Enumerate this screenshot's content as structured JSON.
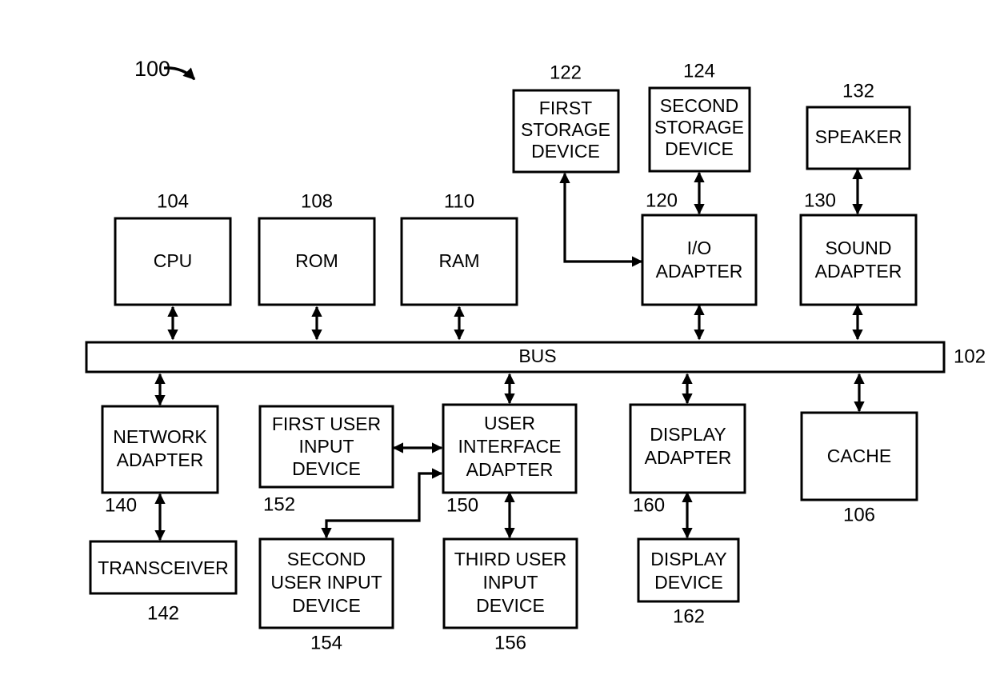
{
  "figure": {
    "figure_ref": "100",
    "background_color": "#ffffff",
    "line_color": "#000000"
  },
  "bus": {
    "label": "BUS",
    "ref": "102"
  },
  "blocks": [
    {
      "id": "cpu",
      "lines": [
        "CPU"
      ],
      "ref": "104"
    },
    {
      "id": "rom",
      "lines": [
        "ROM"
      ],
      "ref": "108"
    },
    {
      "id": "ram",
      "lines": [
        "RAM"
      ],
      "ref": "110"
    },
    {
      "id": "first-storage",
      "lines": [
        "FIRST",
        "STORAGE",
        "DEVICE"
      ],
      "ref": "122"
    },
    {
      "id": "second-storage",
      "lines": [
        "SECOND",
        "STORAGE",
        "DEVICE"
      ],
      "ref": "124"
    },
    {
      "id": "io-adapter",
      "lines": [
        "I/O",
        "ADAPTER"
      ],
      "ref": "120"
    },
    {
      "id": "speaker",
      "lines": [
        "SPEAKER"
      ],
      "ref": "132"
    },
    {
      "id": "sound-adapter",
      "lines": [
        "SOUND",
        "ADAPTER"
      ],
      "ref": "130"
    },
    {
      "id": "network-adapter",
      "lines": [
        "NETWORK",
        "ADAPTER"
      ],
      "ref": "140"
    },
    {
      "id": "transceiver",
      "lines": [
        "TRANSCEIVER"
      ],
      "ref": "142"
    },
    {
      "id": "first-user-input",
      "lines": [
        "FIRST USER",
        "INPUT",
        "DEVICE"
      ],
      "ref": "152"
    },
    {
      "id": "ui-adapter",
      "lines": [
        "USER",
        "INTERFACE",
        "ADAPTER"
      ],
      "ref": "150"
    },
    {
      "id": "second-user-input",
      "lines": [
        "SECOND",
        "USER INPUT",
        "DEVICE"
      ],
      "ref": "154"
    },
    {
      "id": "third-user-input",
      "lines": [
        "THIRD USER",
        "INPUT",
        "DEVICE"
      ],
      "ref": "156"
    },
    {
      "id": "display-adapter",
      "lines": [
        "DISPLAY",
        "ADAPTER"
      ],
      "ref": "160"
    },
    {
      "id": "display-device",
      "lines": [
        "DISPLAY",
        "DEVICE"
      ],
      "ref": "162"
    },
    {
      "id": "cache",
      "lines": [
        "CACHE"
      ],
      "ref": "106"
    }
  ]
}
